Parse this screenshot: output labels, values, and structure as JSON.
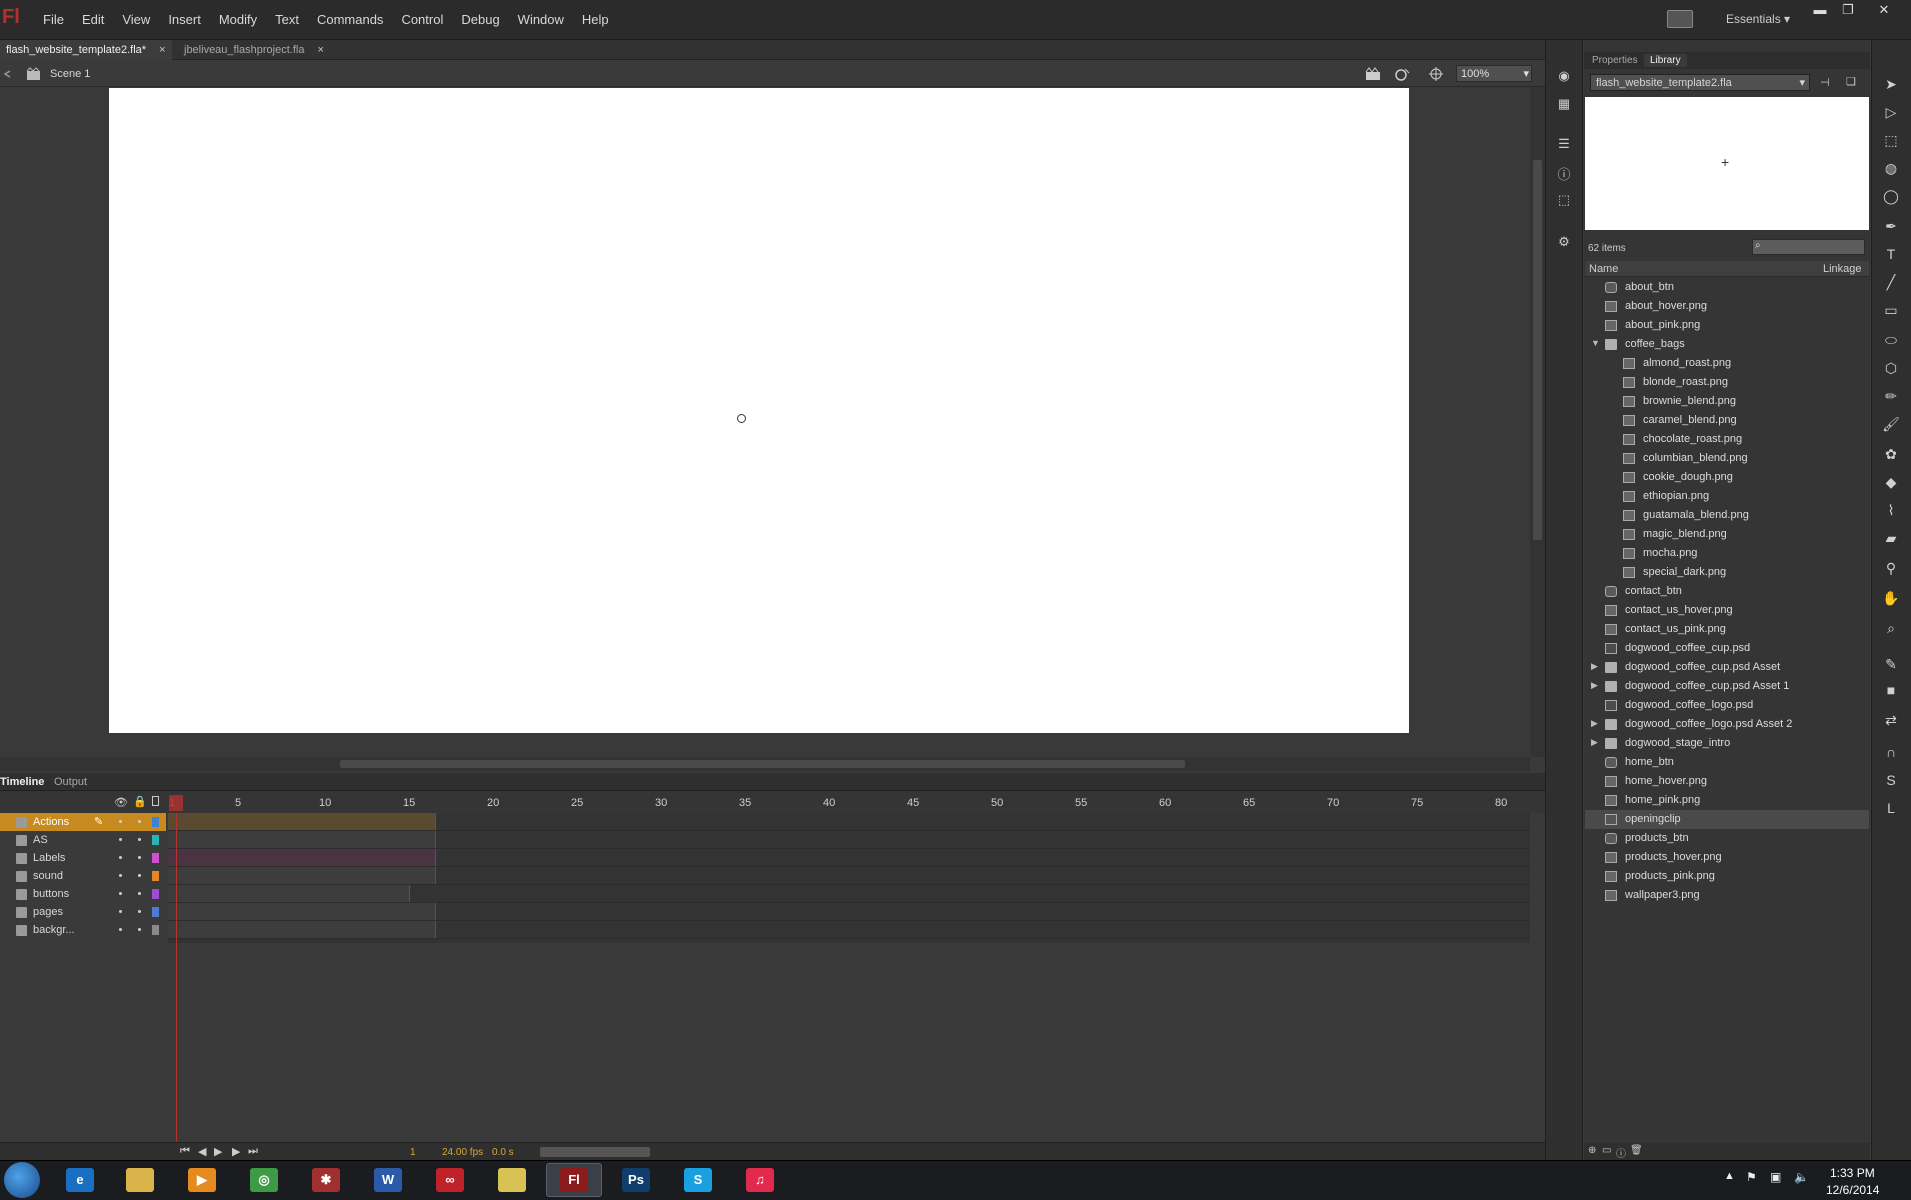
{
  "app": {
    "logo": "Fl"
  },
  "menus": [
    "File",
    "Edit",
    "View",
    "Insert",
    "Modify",
    "Text",
    "Commands",
    "Control",
    "Debug",
    "Window",
    "Help"
  ],
  "workspace": {
    "label": "Essentials"
  },
  "window_controls": {
    "minimize": "▬",
    "restore": "❐",
    "close": "✕"
  },
  "doc_tabs": [
    {
      "label": "flash_website_template2.fla*",
      "close": "×"
    },
    {
      "label": "jbeliveau_flashproject.fla",
      "close": "×"
    }
  ],
  "editbar": {
    "scene": "Scene 1",
    "zoom": "100%"
  },
  "timeline": {
    "tabs": [
      "Timeline",
      "Output"
    ],
    "frame_numbers": [
      "1",
      "5",
      "10",
      "15",
      "20",
      "25",
      "30",
      "35",
      "40",
      "45",
      "50",
      "55",
      "60",
      "65",
      "70",
      "75",
      "80"
    ],
    "layers": [
      {
        "name": "Actions",
        "color": "#3e83d6",
        "selected": true
      },
      {
        "name": "AS",
        "color": "#2bb3b3"
      },
      {
        "name": "Labels",
        "color": "#d04fd0"
      },
      {
        "name": "sound",
        "color": "#e5862a"
      },
      {
        "name": "buttons",
        "color": "#9b4fd0"
      },
      {
        "name": "pages",
        "color": "#4f7ad0"
      },
      {
        "name": "backgr...",
        "color": "#8a8a8a"
      }
    ],
    "current_frame": "1",
    "fps": "24.00 fps",
    "time": "0.0 s"
  },
  "library": {
    "tabs": [
      "Properties",
      "Library"
    ],
    "document": "flash_website_template2.fla",
    "count": "62 items",
    "col_name": "Name",
    "col_linkage": "Linkage",
    "items": [
      {
        "label": "about_btn",
        "type": "button",
        "indent": 0
      },
      {
        "label": "about_hover.png",
        "type": "bitmap",
        "indent": 0
      },
      {
        "label": "about_pink.png",
        "type": "bitmap",
        "indent": 0
      },
      {
        "label": "coffee_bags",
        "type": "folder",
        "indent": 0,
        "expanded": true
      },
      {
        "label": "almond_roast.png",
        "type": "bitmap",
        "indent": 1
      },
      {
        "label": "blonde_roast.png",
        "type": "bitmap",
        "indent": 1
      },
      {
        "label": "brownie_blend.png",
        "type": "bitmap",
        "indent": 1
      },
      {
        "label": "caramel_blend.png",
        "type": "bitmap",
        "indent": 1
      },
      {
        "label": "chocolate_roast.png",
        "type": "bitmap",
        "indent": 1
      },
      {
        "label": "columbian_blend.png",
        "type": "bitmap",
        "indent": 1
      },
      {
        "label": "cookie_dough.png",
        "type": "bitmap",
        "indent": 1
      },
      {
        "label": "ethiopian.png",
        "type": "bitmap",
        "indent": 1
      },
      {
        "label": "guatamala_blend.png",
        "type": "bitmap",
        "indent": 1
      },
      {
        "label": "magic_blend.png",
        "type": "bitmap",
        "indent": 1
      },
      {
        "label": "mocha.png",
        "type": "bitmap",
        "indent": 1
      },
      {
        "label": "special_dark.png",
        "type": "bitmap",
        "indent": 1
      },
      {
        "label": "contact_btn",
        "type": "button",
        "indent": 0
      },
      {
        "label": "contact_us_hover.png",
        "type": "bitmap",
        "indent": 0
      },
      {
        "label": "contact_us_pink.png",
        "type": "bitmap",
        "indent": 0
      },
      {
        "label": "dogwood_coffee_cup.psd",
        "type": "graphic",
        "indent": 0
      },
      {
        "label": "dogwood_coffee_cup.psd Asset",
        "type": "folder",
        "indent": 0,
        "collapsed": true
      },
      {
        "label": "dogwood_coffee_cup.psd Asset 1",
        "type": "folder",
        "indent": 0,
        "collapsed": true
      },
      {
        "label": "dogwood_coffee_logo.psd",
        "type": "graphic",
        "indent": 0
      },
      {
        "label": "dogwood_coffee_logo.psd Asset 2",
        "type": "folder",
        "indent": 0,
        "collapsed": true
      },
      {
        "label": "dogwood_stage_intro",
        "type": "folder",
        "indent": 0,
        "collapsed": true
      },
      {
        "label": "home_btn",
        "type": "button",
        "indent": 0
      },
      {
        "label": "home_hover.png",
        "type": "bitmap",
        "indent": 0
      },
      {
        "label": "home_pink.png",
        "type": "bitmap",
        "indent": 0
      },
      {
        "label": "openingclip",
        "type": "movieclip",
        "indent": 0,
        "selected": true
      },
      {
        "label": "products_btn",
        "type": "button",
        "indent": 0
      },
      {
        "label": "products_hover.png",
        "type": "bitmap",
        "indent": 0
      },
      {
        "label": "products_pink.png",
        "type": "bitmap",
        "indent": 0
      },
      {
        "label": "wallpaper3.png",
        "type": "bitmap",
        "indent": 0
      }
    ]
  },
  "tools": [
    "selection-tool",
    "subselection-tool",
    "free-transform-tool",
    "3d-rotation-tool",
    "lasso-tool",
    "pen-tool",
    "text-tool",
    "line-tool",
    "rectangle-tool",
    "oval-tool",
    "polystar-tool",
    "pencil-tool",
    "brush-tool",
    "deco-tool",
    "paint-bucket-tool",
    "eyedropper-tool",
    "eraser-tool",
    "bone-tool",
    "hand-tool",
    "zoom-tool",
    "stroke-color",
    "fill-color",
    "swap-colors",
    "snap-tool",
    "smooth-tool",
    "straighten-tool"
  ],
  "taskbar": {
    "apps": [
      "ie",
      "explorer",
      "media",
      "chrome",
      "app5",
      "word",
      "creative-cloud",
      "folder",
      "flash",
      "photoshop",
      "skype",
      "itunes"
    ],
    "flash_glyph": "Fl",
    "photoshop_glyph": "Ps",
    "word_glyph": "W",
    "skype_glyph": "S",
    "time": "1:33 PM",
    "date": "12/6/2014"
  },
  "colors": {
    "accent": "#b8312f",
    "stage": "#ffffff",
    "fps": "#d7a73a"
  }
}
